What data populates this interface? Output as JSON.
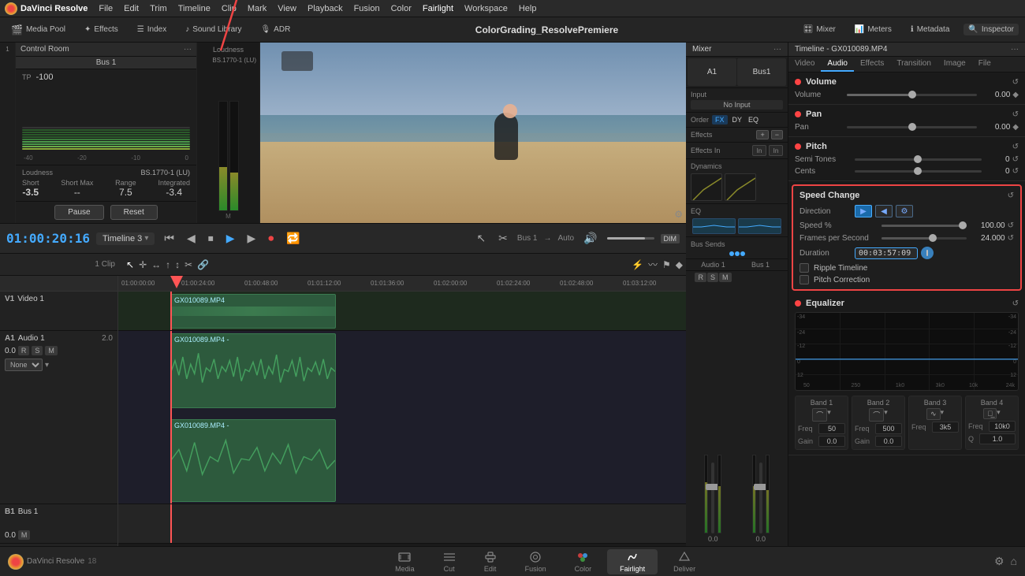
{
  "app": {
    "name": "DaVinci Resolve",
    "version": "18",
    "title": "ColorGrading_ResolvePremiere"
  },
  "menubar": {
    "items": [
      "DaVinci Resolve",
      "File",
      "Edit",
      "Trim",
      "Timeline",
      "Clip",
      "Mark",
      "View",
      "Playback",
      "Fusion",
      "Color",
      "Fairlight",
      "Workspace",
      "Help"
    ]
  },
  "toolbar": {
    "media_pool": "Media Pool",
    "effects": "Effects",
    "index": "Index",
    "sound_library": "Sound Library",
    "adr": "ADR",
    "title": "ColorGrading_ResolvePremiere",
    "mixer_label": "Mixer",
    "meters_label": "Meters",
    "metadata_label": "Metadata",
    "inspector_label": "Inspector"
  },
  "transport": {
    "timecode": "01:00:20:16",
    "timeline_name": "Timeline 3",
    "bus": "Bus 1",
    "routing": "Auto"
  },
  "tracks": {
    "video": {
      "label": "V1",
      "name": "Video 1",
      "clip": "GX010089.MP4"
    },
    "audio": {
      "label": "A1",
      "name": "Audio 1",
      "volume": "2.0",
      "clip": "GX010089.MP4",
      "vol_display": "0.0",
      "none_label": "None"
    },
    "bus": {
      "label": "B1",
      "name": "Bus 1",
      "vol_display": "0.0"
    },
    "clips_label": "1 Clip"
  },
  "mixer": {
    "title": "Mixer",
    "channel_a1": "A1",
    "channel_bus1": "Bus1",
    "input_label": "Input",
    "input_value": "No Input",
    "order_label": "Order",
    "order_fx": "FX",
    "order_dy": "DY",
    "order_eq": "EQ",
    "effects_label": "Effects",
    "dynamics_label": "Dynamics",
    "effects_in_label": "Effects In",
    "eq_label": "EQ",
    "bus_sends_label": "Bus Sends",
    "audio1_label": "Audio 1",
    "bus1_label": "Bus 1"
  },
  "control_room": {
    "title": "Control Room",
    "tp_label": "TP",
    "tp_value": "-100",
    "loudness_label": "Loudness",
    "loudness_format": "BS.1770-1 (LU)",
    "short_label": "Short",
    "short_value": "-3.5",
    "short_max_label": "Short Max",
    "short_max_value": "--",
    "range_label": "Range",
    "range_value": "7.5",
    "integrated_label": "Integrated",
    "integrated_value": "-3.4",
    "pause_btn": "Pause",
    "reset_btn": "Reset"
  },
  "inspector": {
    "title": "Timeline - GX010089.MP4",
    "tabs": [
      "Video",
      "Audio",
      "Effects",
      "Transition",
      "Image",
      "File"
    ],
    "active_tab": "Audio",
    "volume_section": {
      "title": "Volume",
      "volume_label": "Volume",
      "volume_value": "0.00"
    },
    "pan_section": {
      "title": "Pan",
      "pan_label": "Pan",
      "pan_value": "0.00"
    },
    "pitch_section": {
      "title": "Pitch",
      "semi_tones_label": "Semi Tones",
      "semi_tones_value": "0",
      "cents_label": "Cents",
      "cents_value": "0"
    },
    "speed_change": {
      "title": "Speed Change",
      "direction_label": "Direction",
      "speed_label": "Speed %",
      "speed_value": "100.00",
      "fps_label": "Frames per Second",
      "fps_value": "24.000",
      "duration_label": "Duration",
      "duration_value": "00:03:57:09",
      "ripple_label": "Ripple Timeline",
      "pitch_corr_label": "Pitch Correction"
    },
    "equalizer": {
      "title": "Equalizer",
      "bands": [
        {
          "label": "Band 1",
          "freq": "50",
          "gain": "0.0"
        },
        {
          "label": "Band 2",
          "freq": "500",
          "gain": "0.0"
        },
        {
          "label": "Band 3",
          "freq": "3k5"
        },
        {
          "label": "Band 4",
          "freq": "10k0"
        }
      ],
      "x_labels": [
        "-34",
        "-24",
        "-12",
        "0",
        "12",
        "24"
      ],
      "freq_labels": [
        "50",
        "250",
        "1k0",
        "3k0",
        "10k",
        "24k"
      ]
    }
  },
  "bottom_tabs": [
    {
      "id": "media",
      "label": "Media",
      "icon": "film"
    },
    {
      "id": "cut",
      "label": "Cut",
      "icon": "scissors"
    },
    {
      "id": "edit",
      "label": "Edit",
      "icon": "edit"
    },
    {
      "id": "fusion",
      "label": "Fusion",
      "icon": "fusion"
    },
    {
      "id": "color",
      "label": "Color",
      "icon": "color"
    },
    {
      "id": "fairlight",
      "label": "Fairlight",
      "icon": "music",
      "active": true
    },
    {
      "id": "deliver",
      "label": "Deliver",
      "icon": "deliver"
    }
  ],
  "timeline_markers": [
    "01:00:00:00",
    "01:00:24:00",
    "01:00:48:00",
    "01:01:12:00",
    "01:01:36:00",
    "01:02:00:00",
    "01:02:24:00",
    "01:02:48:00",
    "01:03:12:00"
  ],
  "colors": {
    "accent": "#4af",
    "red": "#e44",
    "green_clip": "#2d5a3d",
    "active_tab": "#4aafff",
    "speed_border": "#e44444"
  }
}
